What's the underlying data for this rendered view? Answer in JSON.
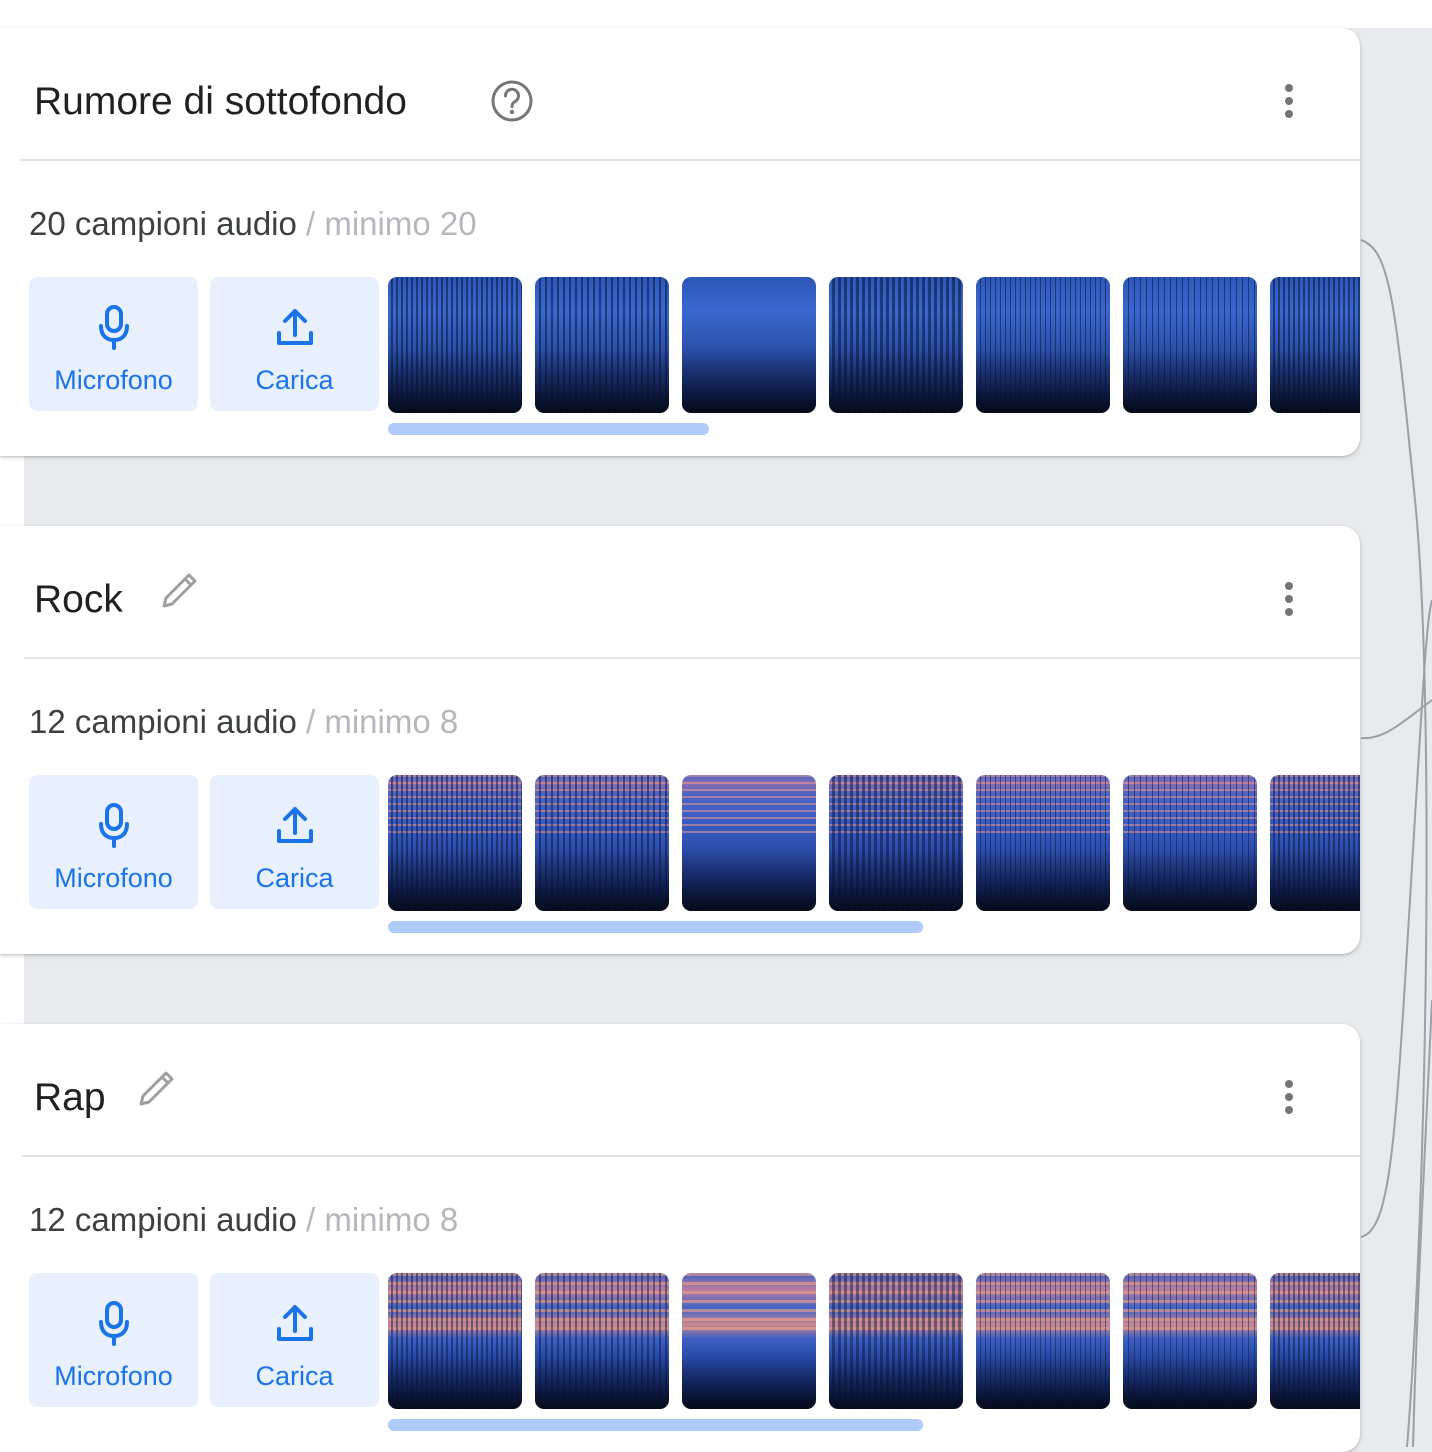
{
  "classes": [
    {
      "title": "Rumore di sottofondo",
      "title_icon": "help-circle-icon",
      "count_text": "20 campioni audio",
      "minimum_text": " / minimo 20",
      "microphone_label": "Microfono",
      "upload_label": "Carica",
      "scroll_fraction": 0.33
    },
    {
      "title": "Rock",
      "title_icon": "pencil-icon",
      "count_text": "12 campioni audio",
      "minimum_text": " / minimo 8",
      "microphone_label": "Microfono",
      "upload_label": "Carica",
      "scroll_fraction": 0.55
    },
    {
      "title": "Rap",
      "title_icon": "pencil-icon",
      "count_text": "12 campioni audio",
      "minimum_text": " / minimo 8",
      "microphone_label": "Microfono",
      "upload_label": "Carica",
      "scroll_fraction": 0.55
    }
  ],
  "colors": {
    "accent": "#1a73e8",
    "button_bg": "#e8f0fe",
    "scrollbar": "#aecbfa",
    "page_bg": "#e8eaed"
  }
}
